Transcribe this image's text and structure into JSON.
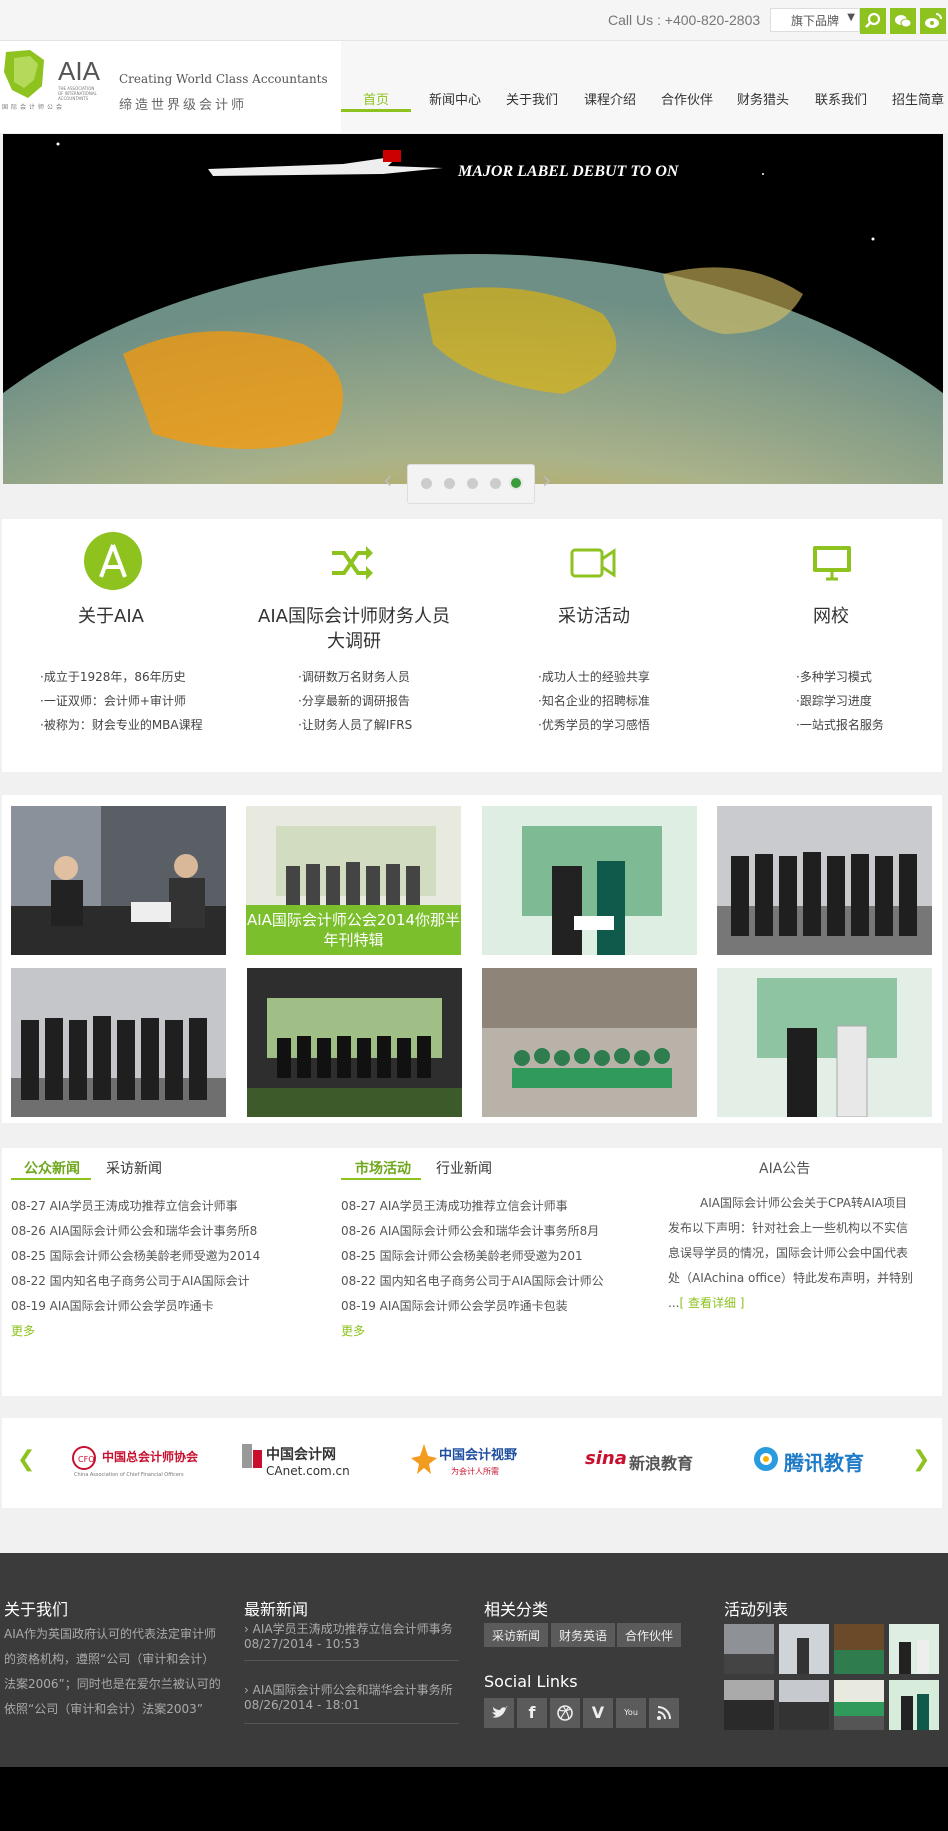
{
  "topbar": {
    "call": "Call Us : +400-820-2803",
    "brand_select": "旗下品牌"
  },
  "logo": {
    "brand": "AIA",
    "subtitle": "THE ASSOCIATION OF INTERNATIONAL ACCOUNTANTS",
    "cn": "国 际 会 计 师 公 会"
  },
  "slogan": {
    "en": "Creating World Class Accountants",
    "cn": "缔造世界级会计师"
  },
  "nav": [
    "首页",
    "新闻中心",
    "关于我们",
    "课程介绍",
    "合作伙伴",
    "财务猎头",
    "联系我们",
    "招生简章"
  ],
  "banner": {
    "text": "MAJOR LABEL DEBUT TO ON",
    "slides": 5,
    "active_slide": 5
  },
  "features": [
    {
      "title": "关于AIA",
      "icon": "aia-logo-icon",
      "items": [
        "·成立于1928年，86年历史",
        "·一证双师：会计师+审计师",
        "·被称为：财会专业的MBA课程"
      ]
    },
    {
      "title": "AIA国际会计师财务人员大调研",
      "icon": "shuffle-icon",
      "items": [
        "·调研数万名财务人员",
        "·分享最新的调研报告",
        "·让财务人员了解IFRS"
      ]
    },
    {
      "title": "采访活动",
      "icon": "video-camera-icon",
      "items": [
        "·成功人士的经验共享",
        "·知名企业的招聘标准",
        "·优秀学员的学习感悟"
      ]
    },
    {
      "title": "网校",
      "icon": "monitor-icon",
      "items": [
        "·多种学习模式",
        "·跟踪学习进度",
        "·一站式报名服务"
      ]
    }
  ],
  "photo_caption": "AIA国际会计师公会2014你那半年刊特辑",
  "news_left": {
    "tabs": [
      "公众新闻",
      "采访新闻"
    ],
    "items": [
      "08-27 AIA学员王涛成功推荐立信会计师事",
      "08-26 AIA国际会计师公会和瑞华会计事务所8",
      "08-25 国际会计师公会杨美龄老师受邀为2014",
      "08-22 国内知名电子商务公司于AIA国际会计",
      "08-19 AIA国际会计师公会学员咋通卡"
    ],
    "more": "更多"
  },
  "news_mid": {
    "tabs": [
      "市场活动",
      "行业新闻"
    ],
    "items": [
      "08-27 AIA学员王涛成功推荐立信会计师事",
      "08-26 AIA国际会计师公会和瑞华会计事务所8月",
      "08-25 国际会计师公会杨美龄老师受邀为201",
      "08-22 国内知名电子商务公司于AIA国际会计师公",
      "08-19 AIA国际会计师公会学员咋通卡包装"
    ],
    "more": "更多"
  },
  "announcement": {
    "title": "AIA公告",
    "lines": [
      "AIA国际会计师公会关于CPA转AIA项目",
      "发布以下声明：针对社会上一些机构以不实信",
      "息误导学员的情况，国际会计师公会中国代表",
      "处（AIAchina office）特此发布声明，并特别"
    ],
    "prefix": "...",
    "link": "[ 查看详细 ]"
  },
  "partners": [
    {
      "name": "中国总会计师协会",
      "sub": "China Association of Chief Financial Officers"
    },
    {
      "name": "中国会计网",
      "sub": "CAnet.com.cn"
    },
    {
      "name": "中国会计视野",
      "sub": "为会计人所需"
    },
    {
      "name": "新浪教育",
      "sub": "sina"
    },
    {
      "name": "腾讯教育",
      "sub": ""
    }
  ],
  "partner_arrows": {
    "left": "❮",
    "right": "❯"
  },
  "footer": {
    "about": {
      "title": "关于我们",
      "text": [
        "AIA作为英国政府认可的代表法定审计师",
        "的资格机构，遵照“公司（审计和会计）",
        "法案2006”；同时也是在爱尔兰被认可的",
        "依照“公司（审计和会计）法案2003”"
      ]
    },
    "latest": {
      "title": "最新新闻",
      "items": [
        {
          "title": "AIA学员王涛成功推荐立信会计师事务",
          "date": "08/27/2014 - 10:53"
        },
        {
          "title": "AIA国际会计师公会和瑞华会计事务所",
          "date": "08/26/2014 - 18:01"
        }
      ]
    },
    "categories": {
      "title": "相关分类",
      "tags": [
        "采访新闻",
        "财务英语",
        "合作伙伴"
      ]
    },
    "social": {
      "title": "Social Links",
      "icons": [
        "twitter-icon",
        "facebook-icon",
        "dribbble-icon",
        "vimeo-icon",
        "youtube-icon",
        "rss-icon"
      ]
    },
    "activities": {
      "title": "活动列表"
    }
  },
  "colors": {
    "accent": "#8dc21f",
    "footer": "#3b3b3b"
  }
}
